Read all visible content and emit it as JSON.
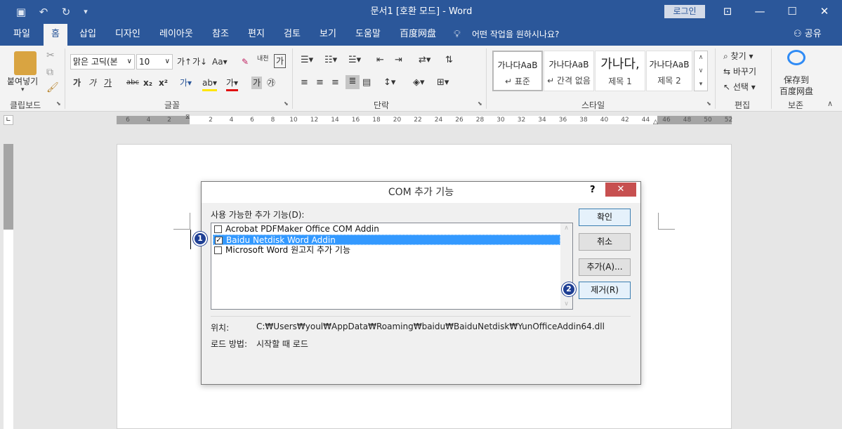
{
  "title_bar": {
    "doc_title": "문서1 [호환 모드]  -  Word",
    "login_label": "로그인",
    "icons": [
      "save-icon",
      "undo-icon",
      "redo-icon",
      "customize-qat-icon",
      "ribbon-display-icon",
      "minimize-icon",
      "maximize-icon",
      "close-icon"
    ],
    "glyphs": {
      "save": "▣",
      "undo": "↶",
      "redo": "↻",
      "qat": "▾",
      "ribbon": "⊡",
      "min": "—",
      "max": "☐",
      "close": "✕"
    }
  },
  "tabs": [
    "파일",
    "홈",
    "삽입",
    "디자인",
    "레이아웃",
    "참조",
    "편지",
    "검토",
    "보기",
    "도움말",
    "百度网盘"
  ],
  "tell_me": "어떤 작업을 원하시나요?",
  "share_label": "공유",
  "ribbon": {
    "clipboard": {
      "paste_label": "붙여넣기",
      "group": "클립보드"
    },
    "font": {
      "font_name": "맑은 고딕(본",
      "font_size": "10",
      "group": "글꼴",
      "row1": [
        "가↑",
        "가↓",
        "Aa▾",
        "✎",
        "내천",
        "가"
      ],
      "row2": [
        "가",
        "가",
        "가",
        "abc",
        "x₂",
        "x²",
        "가▾",
        "ab▾",
        "가▾",
        "가",
        "㉮"
      ]
    },
    "paragraph": {
      "group": "단락"
    },
    "styles": {
      "group": "스타일",
      "items": [
        {
          "preview": "가나다AaB",
          "name": "↵ 표준"
        },
        {
          "preview": "가나다AaB",
          "name": "↵ 간격 없음"
        },
        {
          "preview": "가나다,",
          "name": "제목 1"
        },
        {
          "preview": "가나다AaB",
          "name": "제목 2"
        }
      ]
    },
    "editing": {
      "group": "편집",
      "find": "찾기",
      "replace": "바꾸기",
      "select": "선택"
    },
    "save": {
      "group": "보존",
      "label_line1": "保存到",
      "label_line2": "百度网盘"
    }
  },
  "ruler_ticks": [
    "6",
    "4",
    "2",
    "",
    "2",
    "4",
    "6",
    "8",
    "10",
    "12",
    "14",
    "16",
    "18",
    "20",
    "22",
    "24",
    "26",
    "28",
    "30",
    "32",
    "34",
    "36",
    "38",
    "40",
    "42",
    "44",
    "46",
    "48",
    "50",
    "52"
  ],
  "dialog": {
    "title": "COM 추가 기능",
    "help": "?",
    "close": "✕",
    "list_label": "사용 가능한 추가 기능(D):",
    "items": [
      {
        "label": "Acrobat PDFMaker Office COM Addin",
        "checked": false,
        "selected": false
      },
      {
        "label": "Baidu Netdisk Word Addin",
        "checked": true,
        "selected": true
      },
      {
        "label": "Microsoft Word 원고지 추가 기능",
        "checked": false,
        "selected": false
      }
    ],
    "buttons": {
      "ok": "확인",
      "cancel": "취소",
      "add": "추가(A)...",
      "remove": "제거(R)"
    },
    "location_label": "위치:",
    "location_value": "C:₩Users₩youl₩AppData₩Roaming₩baidu₩BaiduNetdisk₩YunOfficeAddin64.dll",
    "load_label": "로드 방법:",
    "load_value": "시작할 때 로드"
  },
  "callouts": [
    "1",
    "2"
  ]
}
